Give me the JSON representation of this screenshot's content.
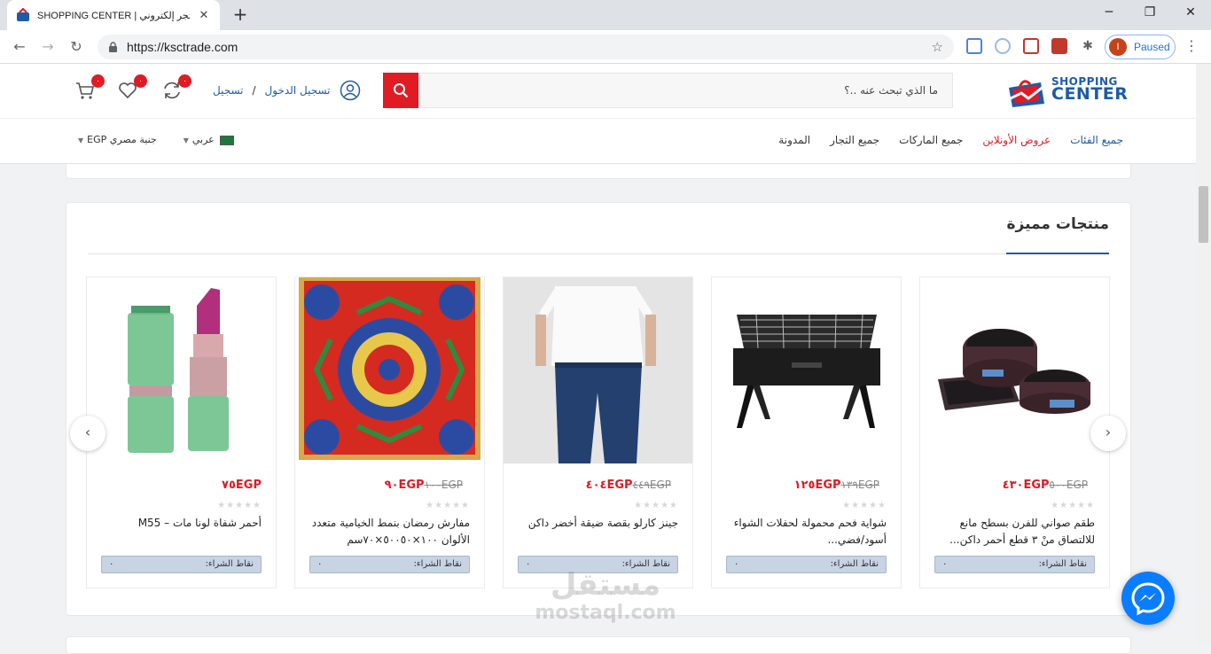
{
  "browser": {
    "tab_title": "SHOPPING CENTER | متجر إلكتروني",
    "tab_close": "✕",
    "new_tab": "+",
    "url": "https://ksctrade.com",
    "profile_initial": "I",
    "profile_status": "Paused",
    "window_controls": [
      "─",
      "❐",
      "✕"
    ]
  },
  "header": {
    "logo_line1": "SHOPPING",
    "logo_line2": "CENTER",
    "search_placeholder": "ما الذي تبحث عنه ..؟",
    "login_label": "تسجيل الدخول",
    "login_sep": "/",
    "register_label": "تسجيل",
    "compare_count": "٠",
    "wishlist_count": "٠",
    "cart_count": "٠"
  },
  "nav": {
    "links": [
      {
        "label": "جميع الفئات",
        "style": "category"
      },
      {
        "label": "عروض الأونلاين",
        "style": "offer"
      },
      {
        "label": "جميع الماركات",
        "style": "normal"
      },
      {
        "label": "جميع التجار",
        "style": "normal"
      },
      {
        "label": "المدونة",
        "style": "normal"
      }
    ],
    "language": "عربي",
    "currency": "جنية مصري EGP"
  },
  "featured": {
    "title": "منتجات مميزة",
    "points_label": "نقاط الشراء:",
    "products": [
      {
        "price": "٤٣٠EGP",
        "old_price": "٥٠٠EGP",
        "name": "طقم صواني للفرن بسطح مانع للالتصاق منْ ٣ قطع أحمر داكن...",
        "points": "٠"
      },
      {
        "price": "١٢٥EGP",
        "old_price": "١٣٩EGP",
        "name": "شواية فحم محمولة لحفلات الشواء أسود/فضي...",
        "points": "٠"
      },
      {
        "price": "٤٠٤EGP",
        "old_price": "٤٤٩EGP",
        "name": "جينز كارلو بقصة ضيقة أخضر داكن",
        "points": "٠"
      },
      {
        "price": "٩٠EGP",
        "old_price": "١٠٠EGP",
        "name": "مفارش رمضان بنمط الخيامية متعدد الألوان ١٠٠×٥٠٠٥٠×٧٠سم",
        "points": "٠"
      },
      {
        "price": "٧٥EGP",
        "old_price": "",
        "name": "أحمر شفاة لونا مات – M55",
        "points": "٠"
      }
    ]
  },
  "watermark": {
    "line1": "مستقل",
    "line2": "mostaql.com"
  },
  "colors": {
    "brand_blue": "#1e5ba8",
    "accent_red": "#e01b24"
  }
}
